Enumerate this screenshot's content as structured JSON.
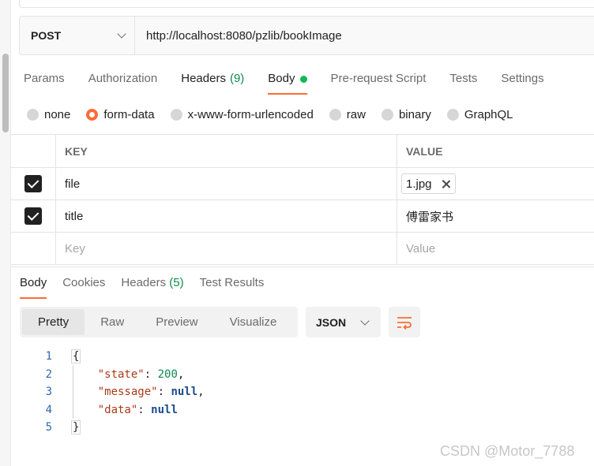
{
  "request": {
    "method": "POST",
    "url": "http://localhost:8080/pzlib/bookImage"
  },
  "request_tabs": [
    {
      "label": "Params"
    },
    {
      "label": "Authorization"
    },
    {
      "label": "Headers",
      "count": "(9)"
    },
    {
      "label": "Body"
    },
    {
      "label": "Pre-request Script"
    },
    {
      "label": "Tests"
    },
    {
      "label": "Settings"
    }
  ],
  "body_types": [
    "none",
    "form-data",
    "x-www-form-urlencoded",
    "raw",
    "binary",
    "GraphQL"
  ],
  "selected_body_type": "form-data",
  "params": {
    "key_header": "KEY",
    "value_header": "VALUE",
    "rows": [
      {
        "key": "file",
        "value": "1.jpg",
        "checked": true
      },
      {
        "key": "title",
        "value": "傅雷家书",
        "checked": true
      }
    ],
    "key_placeholder": "Key",
    "value_placeholder": "Value"
  },
  "response_tabs": [
    {
      "label": "Body"
    },
    {
      "label": "Cookies"
    },
    {
      "label": "Headers",
      "count": "(5)"
    },
    {
      "label": "Test Results"
    }
  ],
  "view_modes": [
    "Pretty",
    "Raw",
    "Preview",
    "Visualize"
  ],
  "format": "JSON",
  "response_body": {
    "line_numbers": [
      "1",
      "2",
      "3",
      "4",
      "5"
    ],
    "open": "{",
    "close": "}",
    "entries": [
      {
        "key": "\"state\"",
        "value": "200",
        "comma": ","
      },
      {
        "key": "\"message\"",
        "value": "null",
        "comma": ","
      },
      {
        "key": "\"data\"",
        "value": "null",
        "comma": ""
      }
    ]
  },
  "watermark": "CSDN @Motor_7788",
  "colors": {
    "accent": "#ff6c37",
    "success": "#0cbb52",
    "count": "#0f8a4f"
  }
}
